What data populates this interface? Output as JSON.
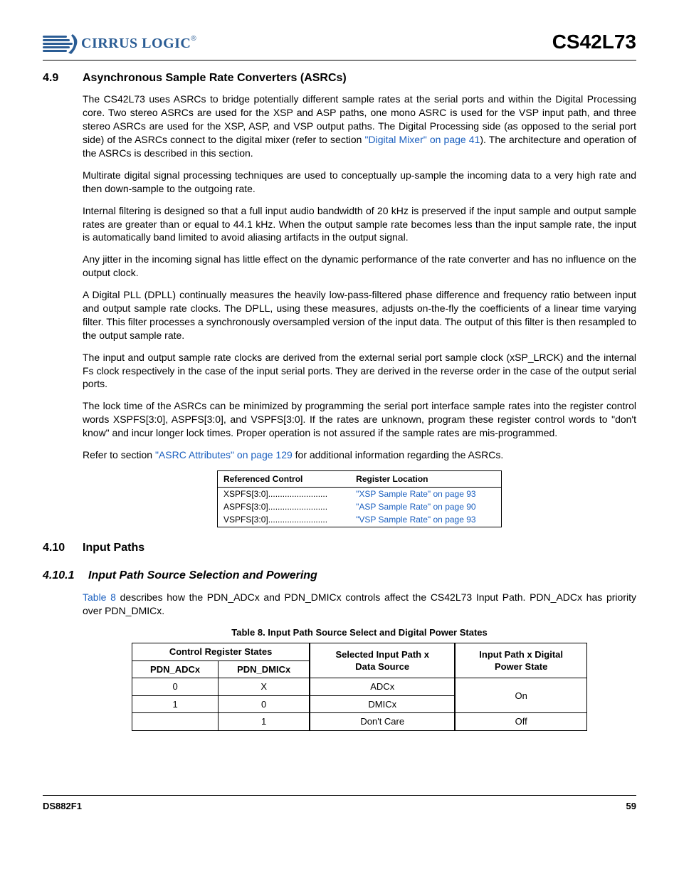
{
  "header": {
    "logo_company": "CIRRUS LOGIC",
    "part_number": "CS42L73"
  },
  "section49": {
    "number": "4.9",
    "title": "Asynchronous Sample Rate Converters (ASRCs)",
    "p1a": "The CS42L73 uses ASRCs to bridge potentially different sample rates at the serial ports and within the Digital Processing core. Two stereo ASRCs are used for the XSP and ASP paths, one mono ASRC is used for the VSP input path, and three stereo ASRCs are used for the XSP, ASP, and VSP output paths. The Digital Processing side (as opposed to the serial port side) of the ASRCs connect to the digital mixer (refer to section ",
    "p1_link": "\"Digital Mixer\" on page 41",
    "p1b": "). The architecture and operation of the ASRCs is described in this section.",
    "p2": "Multirate digital signal processing techniques are used to conceptually up-sample the incoming data to a very high rate and then down-sample to the outgoing rate.",
    "p3": "Internal filtering is designed so that a full input audio bandwidth of 20 kHz is preserved if the input sample and output sample rates are greater than or equal to 44.1 kHz. When the output sample rate becomes less than the input sample rate, the input is automatically band limited to avoid aliasing artifacts in the output signal.",
    "p4": "Any jitter in the incoming signal has little effect on the dynamic performance of the rate converter and has no influence on the output clock.",
    "p5": "A Digital PLL (DPLL) continually measures the heavily low-pass-filtered phase difference and frequency ratio between input and output sample rate clocks. The DPLL, using these measures, adjusts on-the-fly the coefficients of a linear time varying filter. This filter processes a synchronously oversampled version of the input data. The output of this filter is then resampled to the output sample rate.",
    "p6": "The input and output sample rate clocks are derived from the external serial port sample clock (xSP_LRCK) and the internal Fs clock respectively in the case of the input serial ports. They are derived in the reverse order in the case of the output serial ports.",
    "p7": "The lock time of the ASRCs can be minimized by programming the serial port interface sample rates into the register control words XSPFS[3:0], ASPFS[3:0], and VSPFS[3:0]. If the rates are unknown, program these register control words to \"don't know\" and incur longer lock times. Proper operation is not assured if the sample rates are mis-programmed.",
    "p8a": "Refer to section ",
    "p8_link": "\"ASRC Attributes\" on page 129",
    "p8b": " for additional information regarding the ASRCs."
  },
  "ref_table": {
    "col1": "Referenced Control",
    "col2": "Register Location",
    "rows": [
      {
        "control": "XSPFS[3:0]",
        "location": "\"XSP Sample Rate\" on page 93"
      },
      {
        "control": "ASPFS[3:0]",
        "location": "\"ASP Sample Rate\" on page 90"
      },
      {
        "control": "VSPFS[3:0]",
        "location": "\"VSP Sample Rate\" on page 93"
      }
    ]
  },
  "section410": {
    "number": "4.10",
    "title": "Input Paths"
  },
  "section4101": {
    "number": "4.10.1",
    "title": "Input Path Source Selection and Powering",
    "p1_link": "Table 8",
    "p1": " describes how the PDN_ADCx and PDN_DMICx controls affect the CS42L73 Input Path. PDN_ADCx has priority over PDN_DMICx."
  },
  "table8": {
    "caption": "Table 8. Input Path Source Select and Digital Power States",
    "head_group": "Control Register States",
    "head_col1": "PDN_ADCx",
    "head_col2": "PDN_DMICx",
    "head_col3a": "Selected Input Path x",
    "head_col3b": "Data Source",
    "head_col4a": "Input Path x Digital",
    "head_col4b": "Power State",
    "rows": [
      {
        "c1": "0",
        "c2": "X",
        "c3": "ADCx",
        "c4": "On"
      },
      {
        "c1": "1",
        "c2": "0",
        "c3": "DMICx",
        "c4": ""
      },
      {
        "c1": "",
        "c2": "1",
        "c3": "Don't Care",
        "c4": "Off"
      }
    ]
  },
  "footer": {
    "doc_id": "DS882F1",
    "page_number": "59"
  }
}
